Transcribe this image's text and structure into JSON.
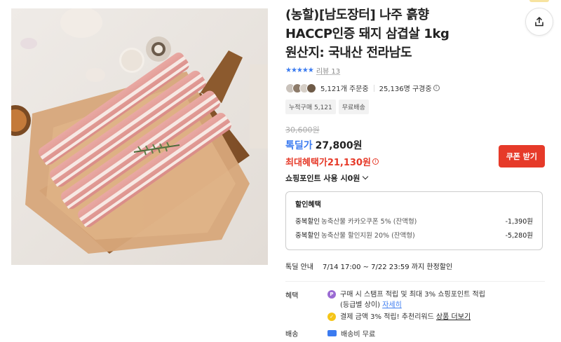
{
  "product": {
    "title_line1": "(농할)[남도장터] 나주 흙향",
    "title_line2": "HACCP인증 돼지 삼겹살 1kg",
    "title_line3": "원산지: 국내산 전라남도",
    "image_alt": "돼지 삼겹살"
  },
  "rating": {
    "stars": "★★★★★",
    "review_label": "리뷰",
    "review_count": "13",
    "score_fraction": 0.9
  },
  "stats": {
    "orders": "5,121개 주문중",
    "watching": "25,136명 구경중"
  },
  "tags": [
    "누적구매 5,121",
    "무료배송"
  ],
  "price": {
    "original": "30,600원",
    "deal_label": "톡딜가",
    "deal_value": "27,800원",
    "max_label": "최대혜택가",
    "max_value": "21,130원",
    "coupon_button": "쿠폰 받기",
    "point_label": "쇼핑포인트 사용 시0원"
  },
  "discount": {
    "title": "할인혜택",
    "rows": [
      {
        "label": "중복할인",
        "desc": "농축산물 카카오쿠폰 5% (잔액형)",
        "value": "-1,390원"
      },
      {
        "label": "중복할인",
        "desc": "농축산물 할인지원 20% (잔액형)",
        "value": "-5,280원"
      }
    ]
  },
  "deal_info": {
    "label": "톡딜 안내",
    "value": "7/14 17:00 ~ 7/22 23:59 까지 한정할인"
  },
  "benefit": {
    "label": "혜택",
    "item1_line1": "구매 시 스탬프 적립 및 최대 3% 쇼핑포인트 적립",
    "item1_line2": "(등급별 상이) ",
    "item1_link": "자세히",
    "item2_text": "결제 금액 3% 적립! 추천리워드 ",
    "item2_link": "상품 더보기"
  },
  "shipping": {
    "label": "배송",
    "value": "배송비 무료"
  },
  "colors": {
    "accent_blue": "#3b7bf0",
    "accent_red": "#e63a29",
    "kakao_yellow": "#f5c518",
    "point_purple": "#9b6bd3"
  }
}
